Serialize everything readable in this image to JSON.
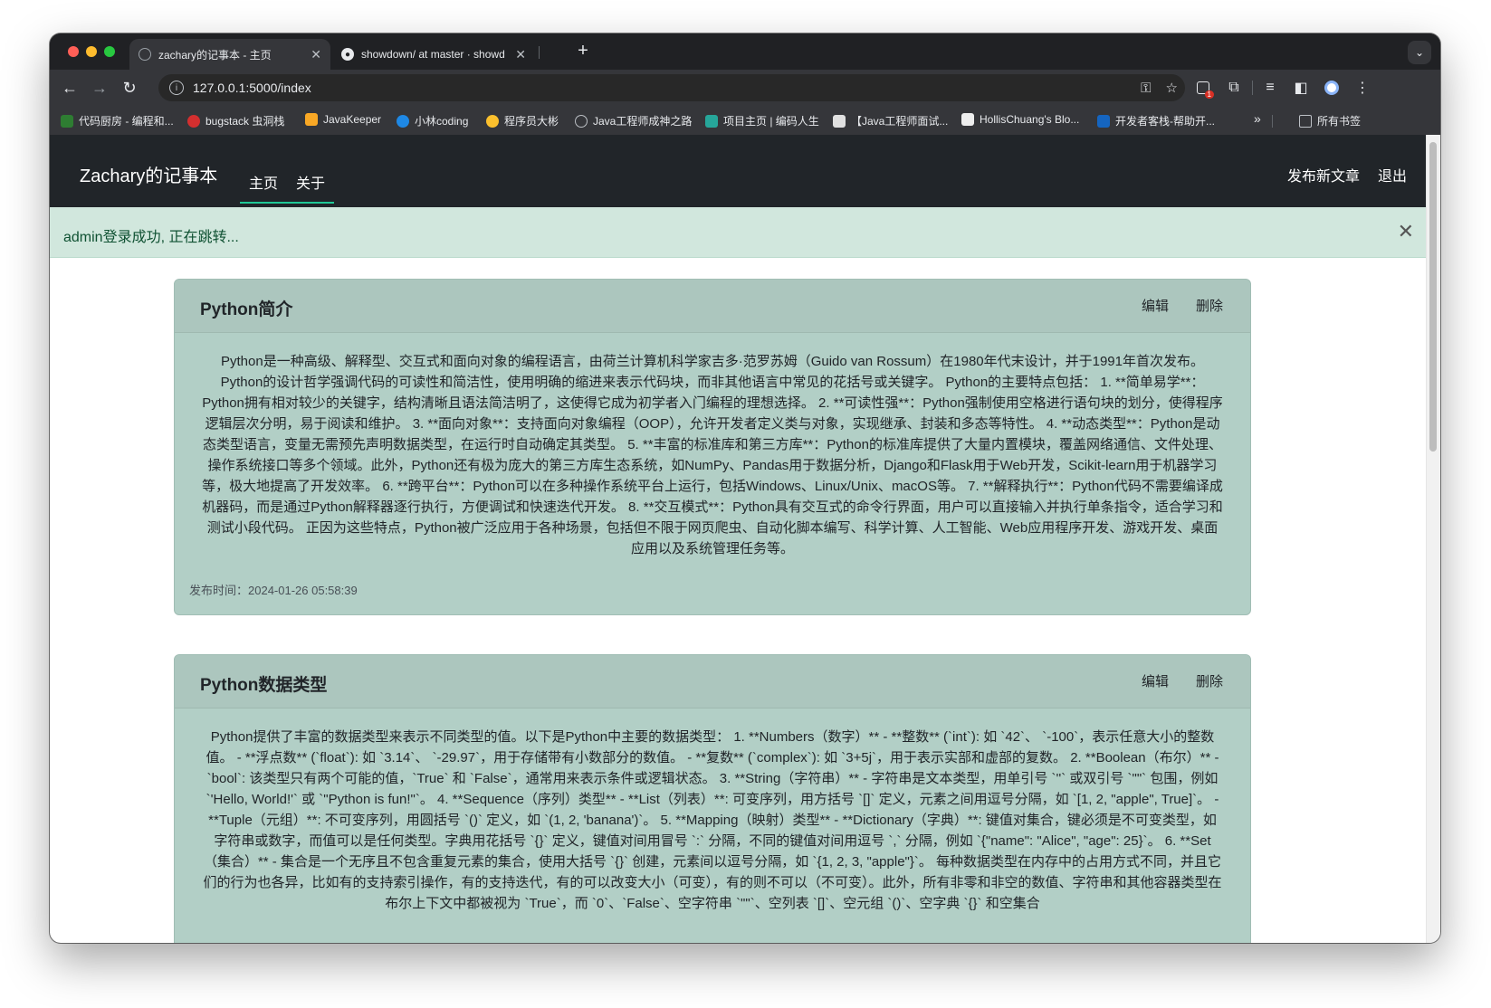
{
  "browser": {
    "tabs": [
      {
        "title": "zachary的记事本 - 主页",
        "active": true
      },
      {
        "title": "showdown/ at master · showd",
        "active": false
      }
    ],
    "new_tab": "+",
    "url": "127.0.0.1:5000/index",
    "bookmarks": [
      "代码厨房 - 编程和...",
      "bugstack 虫洞栈",
      "JavaKeeper",
      "小林coding",
      "程序员大彬",
      "Java工程师成神之路",
      "项目主页 | 编码人生",
      "【Java工程师面试...",
      "HollisChuang's Blo...",
      "开发者客栈-帮助开..."
    ],
    "bookmarks_overflow": "»",
    "all_bookmarks": "所有书签",
    "extension_badge": "1"
  },
  "site": {
    "brand": "Zachary的记事本",
    "nav": [
      "主页",
      "关于"
    ],
    "new_post": "发布新文章",
    "logout": "退出"
  },
  "alert": {
    "message": "admin登录成功, 正在跳转...",
    "close": "✕"
  },
  "posts": [
    {
      "title": "Python简介",
      "edit": "编辑",
      "delete": "删除",
      "content": "Python是一种高级、解释型、交互式和面向对象的编程语言，由荷兰计算机科学家吉多·范罗苏姆（Guido van Rossum）在1980年代末设计，并于1991年首次发布。 Python的设计哲学强调代码的可读性和简洁性，使用明确的缩进来表示代码块，而非其他语言中常见的花括号或关键字。 Python的主要特点包括： 1. **简单易学**：Python拥有相对较少的关键字，结构清晰且语法简洁明了，这使得它成为初学者入门编程的理想选择。 2. **可读性强**：Python强制使用空格进行语句块的划分，使得程序逻辑层次分明，易于阅读和维护。 3. **面向对象**：支持面向对象编程（OOP），允许开发者定义类与对象，实现继承、封装和多态等特性。 4. **动态类型**：Python是动态类型语言，变量无需预先声明数据类型，在运行时自动确定其类型。 5. **丰富的标准库和第三方库**：Python的标准库提供了大量内置模块，覆盖网络通信、文件处理、操作系统接口等多个领域。此外，Python还有极为庞大的第三方库生态系统，如NumPy、Pandas用于数据分析，Django和Flask用于Web开发，Scikit-learn用于机器学习等，极大地提高了开发效率。 6. **跨平台**：Python可以在多种操作系统平台上运行，包括Windows、Linux/Unix、macOS等。 7. **解释执行**：Python代码不需要编译成机器码，而是通过Python解释器逐行执行，方便调试和快速迭代开发。 8. **交互模式**：Python具有交互式的命令行界面，用户可以直接输入并执行单条指令，适合学习和测试小段代码。 正因为这些特点，Python被广泛应用于各种场景，包括但不限于网页爬虫、自动化脚本编写、科学计算、人工智能、Web应用程序开发、游戏开发、桌面应用以及系统管理任务等。",
      "published": "发布时间：2024-01-26 05:58:39"
    },
    {
      "title": "Python数据类型",
      "edit": "编辑",
      "delete": "删除",
      "content": "Python提供了丰富的数据类型来表示不同类型的值。以下是Python中主要的数据类型： 1. **Numbers（数字）** - **整数** (`int`): 如 `42`、 `-100`，表示任意大小的整数值。 - **浮点数** (`float`): 如 `3.14`、 `-29.97`，用于存储带有小数部分的数值。 - **复数** (`complex`): 如 `3+5j`，用于表示实部和虚部的复数。 2. **Boolean（布尔）** - `bool`: 该类型只有两个可能的值，`True` 和 `False`，通常用来表示条件或逻辑状态。 3. **String（字符串）** - 字符串是文本类型，用单引号 `''` 或双引号 `\"\"` 包围，例如 `'Hello, World!'` 或 `\"Python is fun!\"`。 4. **Sequence（序列）类型** - **List（列表）**: 可变序列，用方括号 `[]` 定义，元素之间用逗号分隔，如 `[1, 2, \"apple\", True]`。 - **Tuple（元组）**: 不可变序列，用圆括号 `()` 定义，如 `(1, 2, 'banana')`。 5. **Mapping（映射）类型** - **Dictionary（字典）**: 键值对集合，键必须是不可变类型，如字符串或数字，而值可以是任何类型。字典用花括号 `{}` 定义，键值对间用冒号 `:` 分隔，不同的键值对间用逗号 `,` 分隔，例如 `{\"name\": \"Alice\", \"age\": 25}`。 6. **Set（集合）** - 集合是一个无序且不包含重复元素的集合，使用大括号 `{}` 创建，元素间以逗号分隔，如 `{1, 2, 3, \"apple\"}`。 每种数据类型在内存中的占用方式不同，并且它们的行为也各异，比如有的支持索引操作，有的支持迭代，有的可以改变大小（可变），有的则不可以（不可变）。此外，所有非零和非空的数值、字符串和其他容器类型在布尔上下文中都被视为 `True`，而 `0`、`False`、空字符串 `\"\"`、空列表 `[]`、空元组 `()`、空字典 `{}` 和空集合"
    }
  ],
  "colors": {
    "navbar": "#212529",
    "alert_bg": "#d1e7dd",
    "alert_text": "#0f5132",
    "card_bg": "#b2cfc6",
    "nav_underline": "#20c997"
  }
}
